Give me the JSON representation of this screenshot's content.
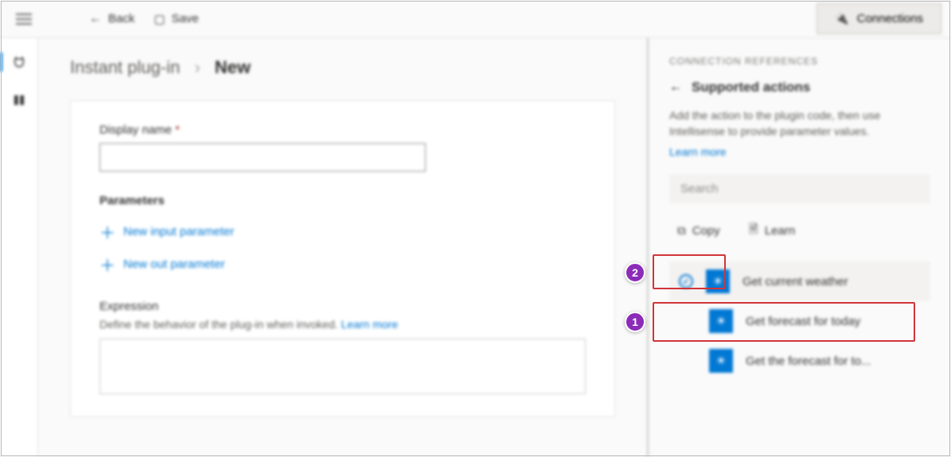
{
  "toolbar": {
    "back_label": "Back",
    "save_label": "Save",
    "connections_label": "Connections"
  },
  "breadcrumb": {
    "parent": "Instant plug-in",
    "current": "New"
  },
  "form": {
    "display_name_label": "Display name",
    "parameters_heading": "Parameters",
    "new_input_label": "New input parameter",
    "new_out_label": "New out parameter",
    "expression_label": "Expression",
    "expression_help": "Define the behavior of the plug-in when invoked.",
    "expression_learn": "Learn more"
  },
  "panel": {
    "eyebrow": "CONNECTION REFERENCES",
    "title": "Supported actions",
    "description": "Add the action to the plugin code, then use Intellisense to provide parameter values.",
    "learn_more": "Learn more",
    "search_placeholder": "Search",
    "copy_label": "Copy",
    "learn_label": "Learn",
    "actions": [
      {
        "label": "Get current weather",
        "selected": true
      },
      {
        "label": "Get forecast for today",
        "selected": false
      },
      {
        "label": "Get the forecast for to...",
        "selected": false
      }
    ]
  },
  "annotations": {
    "callout1": "1",
    "callout2": "2"
  }
}
